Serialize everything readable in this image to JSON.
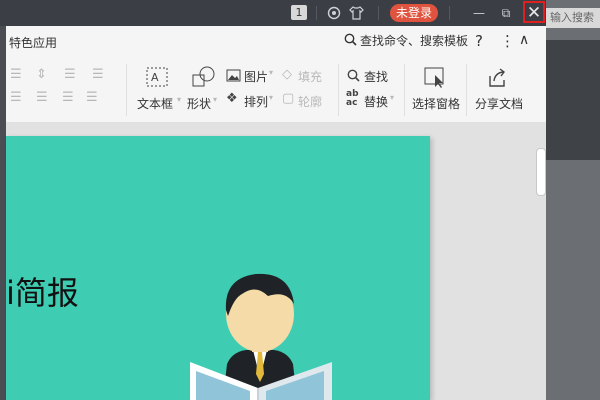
{
  "titlebar": {
    "page_badge": "1",
    "login_label": "未登录",
    "minimize_glyph": "—",
    "restore_glyph": "⧉",
    "close_glyph": "✕"
  },
  "ribbon": {
    "tab_label": "特色应用",
    "search_label": "查找命令、搜索模板",
    "help_glyph": "?",
    "more_glyph": "⋮",
    "collapse_glyph": "∧",
    "textbox_label": "文本框",
    "shape_label": "形状",
    "picture_label": "图片",
    "fill_label": "填充",
    "arrange_label": "排列",
    "outline_label": "轮廓",
    "find_label": "查找",
    "replace_label": "替换",
    "selection_pane_label": "选择窗格",
    "share_label": "分享文档"
  },
  "slide": {
    "title": "i简报",
    "background_color": "#3ecdb2"
  },
  "background": {
    "right_strip_text": "输入搜索"
  },
  "icons": [
    "search-icon",
    "help-icon",
    "more-icon",
    "collapse-icon",
    "textbox-icon",
    "shape-icon",
    "picture-icon",
    "fill-icon",
    "arrange-icon",
    "outline-icon",
    "find-icon",
    "replace-icon",
    "selection-pane-icon",
    "share-icon",
    "skin-icon",
    "shirt-icon",
    "close-icon"
  ]
}
